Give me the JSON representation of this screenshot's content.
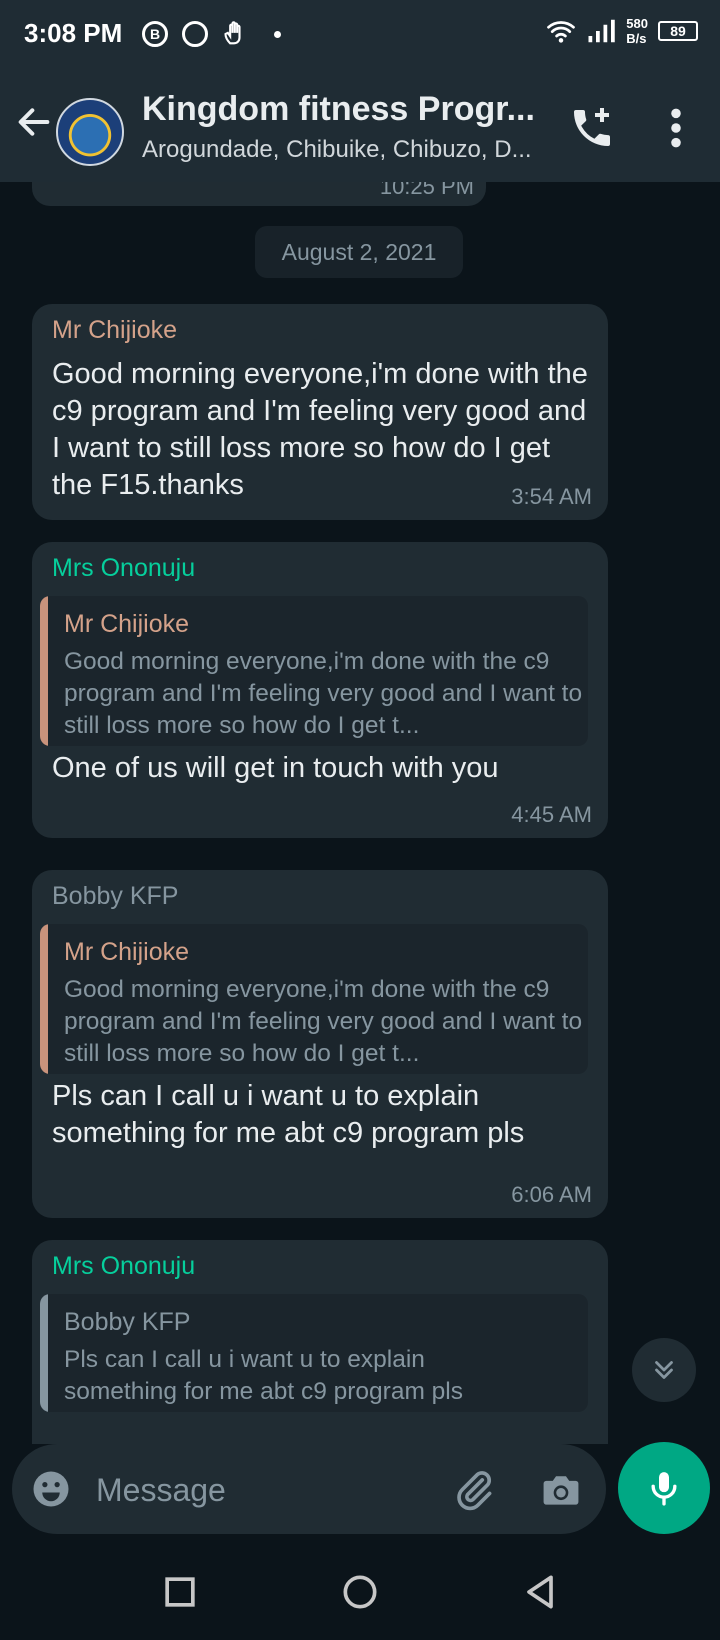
{
  "status_bar": {
    "time": "3:08 PM",
    "speed": "580\nB/s",
    "speed_top": "580",
    "speed_bottom": "B/s",
    "battery": "89"
  },
  "header": {
    "title": "Kingdom fitness Progr...",
    "subtitle": "Arogundade, Chibuike, Chibuzo, D..."
  },
  "chat": {
    "partial_time": "10:25 PM",
    "date_chip": "August 2, 2021",
    "messages": [
      {
        "sender": "Mr Chijioke",
        "sender_color": "#d4a28a",
        "text": "Good morning everyone,i'm done with the c9 program and I'm feeling very good and I want to still loss more so how do I get the F15.thanks",
        "time": "3:54 AM"
      },
      {
        "sender": "Mrs Ononuju",
        "sender_color": "#06cf9c",
        "quote_name": "Mr Chijioke",
        "quote_text": "Good morning everyone,i'm done with the c9 program and I'm feeling very good and I want to still loss more so how do I get t...",
        "text": "One of us will get in touch with you",
        "time": "4:45 AM"
      },
      {
        "sender": "Bobby KFP",
        "sender_color": "#8696a0",
        "quote_name": "Mr Chijioke",
        "quote_text": "Good morning everyone,i'm done with the c9 program and I'm feeling very good and I want to still loss more so how do I get t...",
        "text": "Pls can I call u i want u to explain something for me abt c9 program pls",
        "time": "6:06 AM"
      },
      {
        "sender": "Mrs Ononuju",
        "sender_color": "#06cf9c",
        "quote_name": "Bobby KFP",
        "quote_text": "Pls can I call u i want u to explain something for me abt c9 program  pls"
      }
    ]
  },
  "composer": {
    "placeholder": "Message"
  },
  "colors": {
    "accent": "#00a884",
    "bubble": "#202c33",
    "background": "#0b141a",
    "quote_bar_brown": "#c9937c",
    "quote_bar_grey": "#8696a0"
  }
}
